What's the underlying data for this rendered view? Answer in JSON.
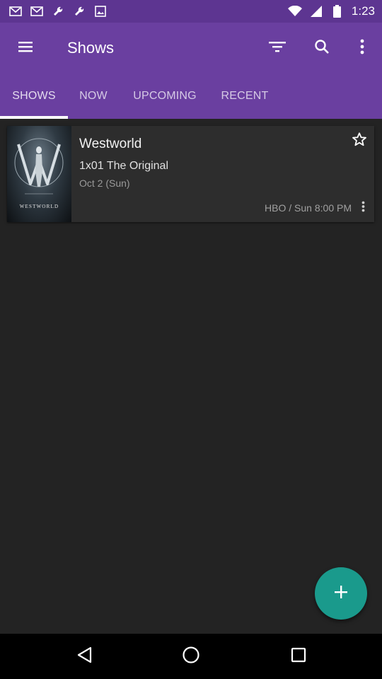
{
  "status_bar": {
    "time": "1:23",
    "icons_left": [
      "gmail-icon",
      "gmail-icon",
      "wrench-icon",
      "wrench-icon",
      "image-icon"
    ],
    "icons_right": [
      "wifi-icon",
      "signal-icon",
      "battery-icon"
    ]
  },
  "app_bar": {
    "title": "Shows",
    "background_color": "#6a3fa0",
    "status_color": "#5d3591"
  },
  "tabs": [
    {
      "label": "SHOWS",
      "active": true
    },
    {
      "label": "NOW",
      "active": false
    },
    {
      "label": "UPCOMING",
      "active": false
    },
    {
      "label": "RECENT",
      "active": false
    }
  ],
  "shows": [
    {
      "title": "Westworld",
      "episode": "1x01 The Original",
      "air_date": "Oct 2 (Sun)",
      "network_time": "HBO / Sun 8:00 PM",
      "poster_text": "WESTWORLD",
      "favorite": false
    }
  ],
  "fab": {
    "icon": "plus-icon",
    "color": "#1a9a8c"
  }
}
